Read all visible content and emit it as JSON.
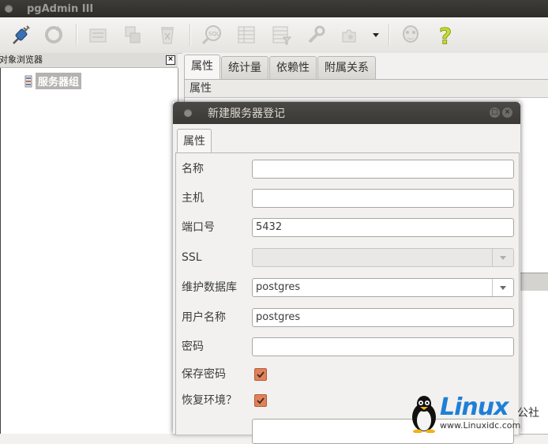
{
  "app": {
    "title": "pgAdmin III"
  },
  "toolbar": {
    "icons": [
      "connect-plug-icon",
      "refresh-icon",
      "properties-icon",
      "create-object-icon",
      "delete-icon",
      "sql-query-icon",
      "view-data-icon",
      "filter-data-icon",
      "maintenance-icon",
      "plugins-icon",
      "tips-icon",
      "help-icon"
    ]
  },
  "browser": {
    "title": "对象浏览器",
    "tree": [
      {
        "label": "服务器组"
      }
    ]
  },
  "properties": {
    "tabs": [
      "属性",
      "统计量",
      "依赖性",
      "附属关系"
    ],
    "active_tab": 0,
    "header": "属性"
  },
  "dialog": {
    "title": "新建服务器登记",
    "tab": "属性",
    "fields": {
      "name": {
        "label": "名称",
        "value": ""
      },
      "host": {
        "label": "主机",
        "value": ""
      },
      "port": {
        "label": "端口号",
        "value": "5432"
      },
      "ssl": {
        "label": "SSL",
        "value": ""
      },
      "maintenance_db": {
        "label": "维护数据库",
        "value": "postgres"
      },
      "username": {
        "label": "用户名称",
        "value": "postgres"
      },
      "password": {
        "label": "密码",
        "value": ""
      },
      "save_password": {
        "label": "保存密码",
        "checked": true
      },
      "restore_env": {
        "label": "恢复环境？",
        "checked": true
      }
    }
  },
  "watermark": {
    "brand": "Linux",
    "cn": "公社",
    "url": "www.Linuxidc.com"
  },
  "colors": {
    "checkbox": "#e0815a",
    "titlebar": "#3d3c38",
    "brand_blue": "#1f7fd6"
  }
}
